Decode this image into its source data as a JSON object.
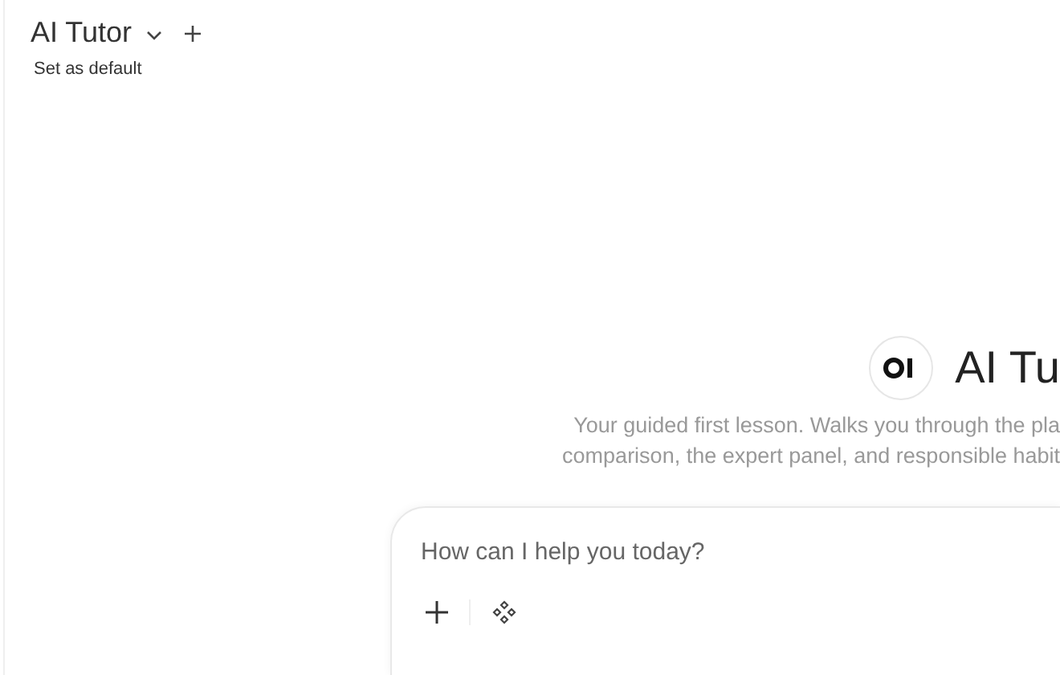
{
  "header": {
    "model_name": "AI Tutor",
    "set_default_link": "Set as default"
  },
  "hero": {
    "title": "AI Tu",
    "description_lines": [
      "Your guided first lesson. Walks you through the pla",
      "comparison, the expert panel, and responsible habit"
    ]
  },
  "composer": {
    "placeholder": "How can I help you today?"
  }
}
